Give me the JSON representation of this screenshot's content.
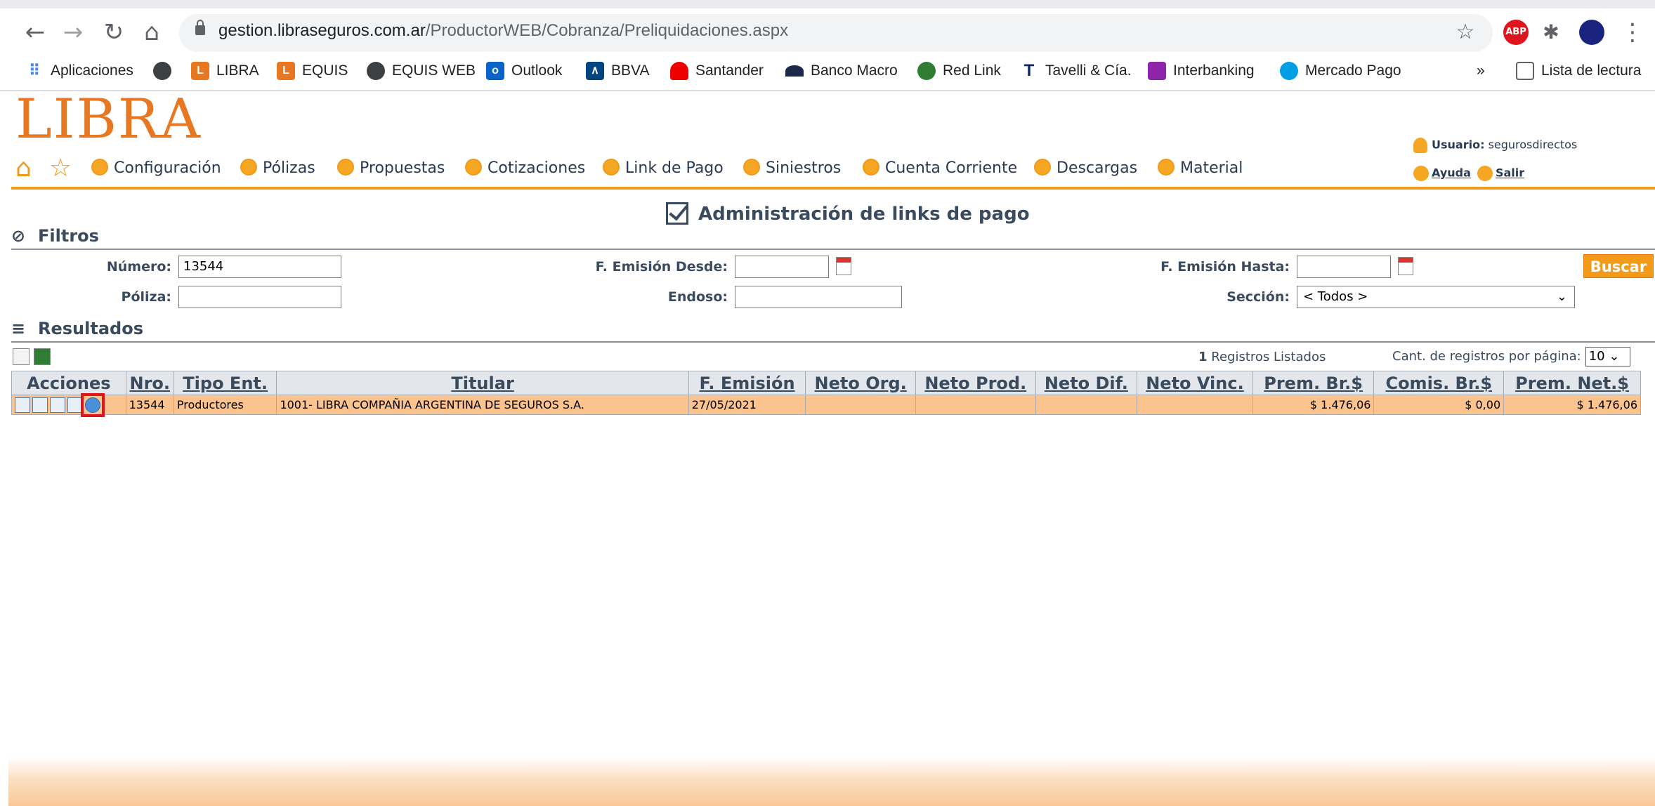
{
  "browser": {
    "url_domain": "gestion.libraseguros.com.ar",
    "url_path": "/ProductorWEB/Cobranza/Preliquidaciones.aspx",
    "bookmarks": [
      "Aplicaciones",
      "LIBRA",
      "EQUIS",
      "EQUIS WEB",
      "Outlook",
      "BBVA",
      "Santander",
      "Banco Macro",
      "Red Link",
      "Tavelli & Cía.",
      "Interbanking",
      "Mercado Pago"
    ],
    "more": "»",
    "reading_list": "Lista de lectura",
    "ext_abp": "ABP"
  },
  "header": {
    "logo": "LIBRA",
    "user_label": "Usuario:",
    "user_name": "segurosdirectos",
    "help": "Ayuda",
    "logout": "Salir",
    "menu": [
      "Configuración",
      "Pólizas",
      "Propuestas",
      "Cotizaciones",
      "Link de Pago",
      "Siniestros",
      "Cuenta Corriente",
      "Descargas",
      "Material"
    ]
  },
  "page_title": "Administración de links de pago",
  "filters": {
    "title": "Filtros",
    "numero_label": "Número:",
    "numero_value": "13544",
    "poliza_label": "Póliza:",
    "desde_label": "F. Emisión Desde:",
    "endoso_label": "Endoso:",
    "hasta_label": "F. Emisión Hasta:",
    "seccion_label": "Sección:",
    "seccion_value": "< Todos >",
    "buscar": "Buscar"
  },
  "results": {
    "title": "Resultados",
    "count": "1",
    "count_label": "Registros Listados",
    "perpage_label": "Cant. de registros por página:",
    "perpage_value": "10",
    "columns": [
      "Acciones",
      "Nro.",
      "Tipo Ent.",
      "Titular",
      "F. Emisión",
      "Neto Org.",
      "Neto Prod.",
      "Neto Dif.",
      "Neto Vinc.",
      "Prem. Br.$",
      "Comis. Br.$",
      "Prem. Net.$"
    ],
    "rows": [
      {
        "nro": "13544",
        "tipo": "Productores",
        "titular": "1001- LIBRA COMPAÑIA ARGENTINA DE SEGUROS S.A.",
        "fecha": "27/05/2021",
        "neto_org": "",
        "neto_prod": "",
        "neto_dif": "",
        "neto_vinc": "",
        "prem_br": "$ 1.476,06",
        "comis_br": "$ 0,00",
        "prem_net": "$ 1.476,06"
      }
    ]
  },
  "colors": {
    "accent": "#f29b1a",
    "logo": "#e87722",
    "row": "#fbc48f",
    "highlight": "#e0141c"
  }
}
